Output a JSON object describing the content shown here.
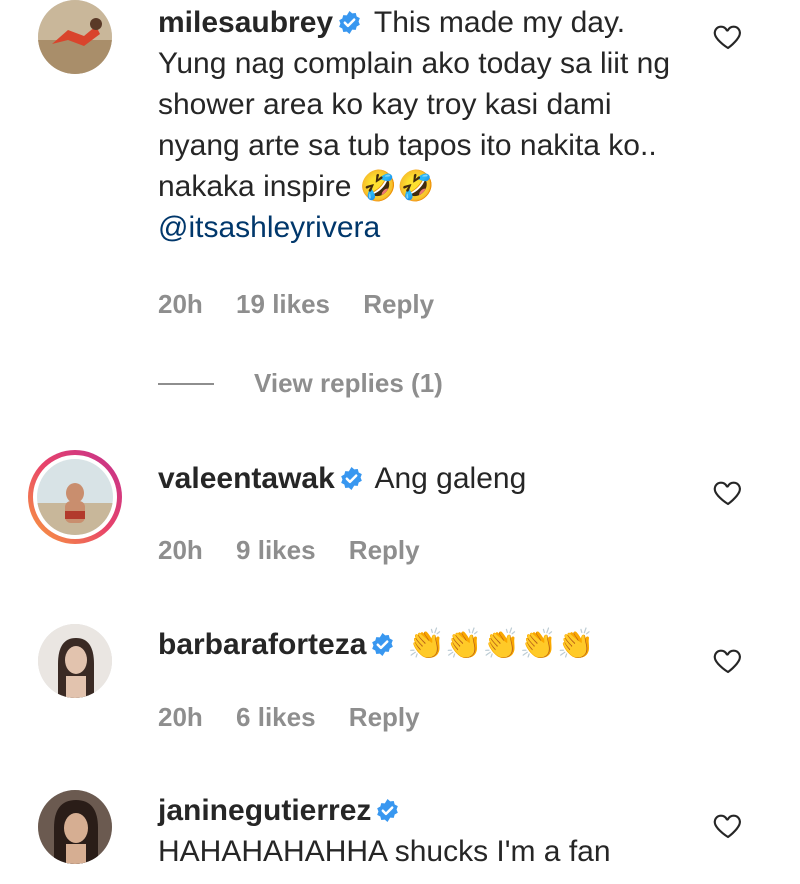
{
  "comments": [
    {
      "username": "milesaubrey",
      "verified": true,
      "text": "This made my day. Yung nag complain ako today sa liit ng shower area ko kay troy kasi dami nyang arte sa tub tapos ito nakita ko.. nakaka inspire 🤣🤣",
      "mention": "@itsashleyrivera",
      "time": "20h",
      "likes": "19 likes",
      "reply": "Reply",
      "view_replies": "View replies (1)"
    },
    {
      "username": "valeentawak",
      "verified": true,
      "text": "Ang galeng",
      "time": "20h",
      "likes": "9 likes",
      "reply": "Reply"
    },
    {
      "username": "barbaraforteza",
      "verified": true,
      "text": "👏👏👏👏👏",
      "time": "20h",
      "likes": "6 likes",
      "reply": "Reply"
    },
    {
      "username": "janinegutierrez",
      "verified": true,
      "text": "HAHAHAHAHHA shucks I'm a fan"
    }
  ],
  "colors": {
    "text": "#262626",
    "meta": "#8e8e8e",
    "mention": "#00376b",
    "verified": "#3897f0"
  },
  "icons": [
    "verified-badge-icon",
    "heart-icon"
  ]
}
